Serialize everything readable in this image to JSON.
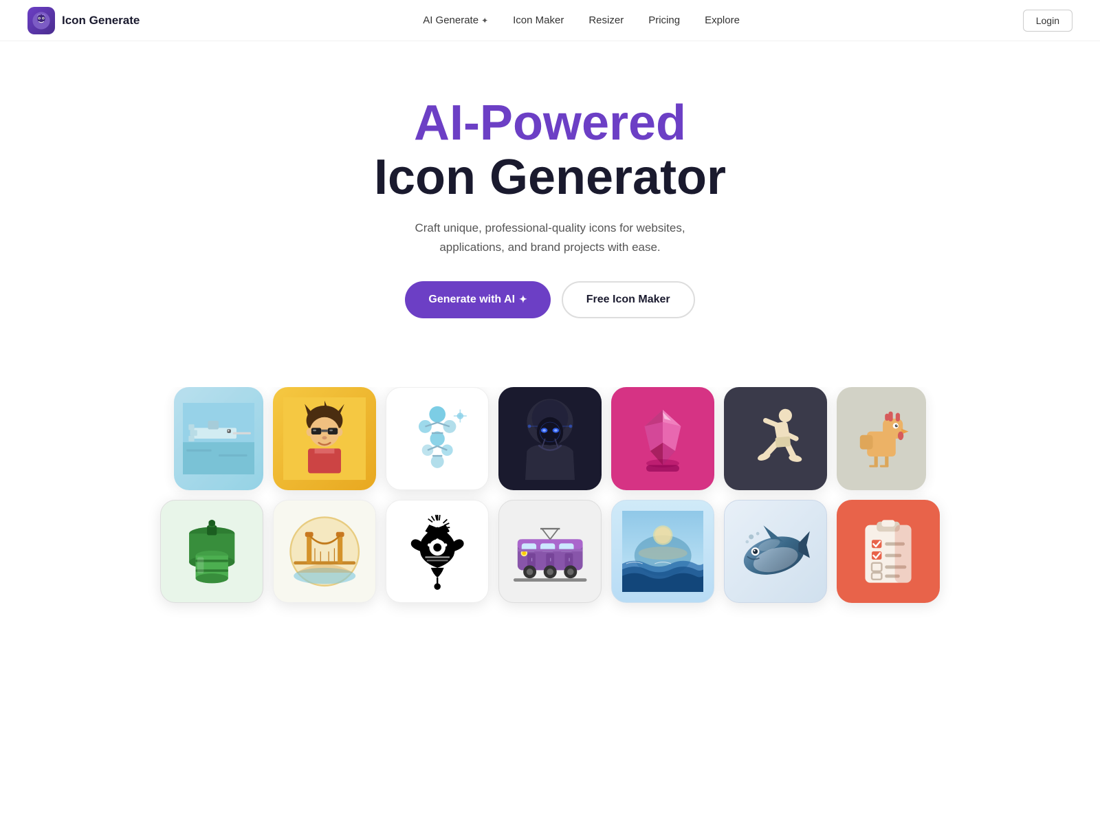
{
  "navbar": {
    "logo_text": "Icon Generate",
    "links": [
      {
        "label": "AI Generate",
        "has_sparkle": true
      },
      {
        "label": "Icon Maker",
        "has_sparkle": false
      },
      {
        "label": "Resizer",
        "has_sparkle": false
      },
      {
        "label": "Pricing",
        "has_sparkle": false
      },
      {
        "label": "Explore",
        "has_sparkle": false
      }
    ],
    "login_label": "Login"
  },
  "hero": {
    "title_ai": "AI-Powered",
    "title_main": "Icon Generator",
    "subtitle_line1": "Craft unique, professional-quality icons for websites,",
    "subtitle_line2": "applications, and brand projects with ease.",
    "cta_primary": "Generate with AI",
    "cta_secondary": "Free Icon Maker",
    "sparkle": "✦"
  },
  "gallery": {
    "row1": [
      {
        "id": "swordfish",
        "bg": "teal",
        "label": "pixel art swordfish"
      },
      {
        "id": "character",
        "bg": "yellow",
        "label": "cartoon character"
      },
      {
        "id": "dna",
        "bg": "white",
        "label": "DNA molecule"
      },
      {
        "id": "hacker",
        "bg": "dark",
        "label": "hooded hacker"
      },
      {
        "id": "gem3d",
        "bg": "pink",
        "label": "3D pink gem"
      },
      {
        "id": "runner",
        "bg": "gray-dark",
        "label": "running figure"
      },
      {
        "id": "chicken",
        "bg": "gray-light",
        "label": "pixel chicken"
      }
    ],
    "row2": [
      {
        "id": "barrels",
        "bg": "white",
        "label": "green barrels"
      },
      {
        "id": "bridge",
        "bg": "white2",
        "label": "golden bridge"
      },
      {
        "id": "ornament",
        "bg": "black-stripe",
        "label": "decorative ornament"
      },
      {
        "id": "train",
        "bg": "white",
        "label": "metro train"
      },
      {
        "id": "waves",
        "bg": "sky",
        "label": "wave landscape"
      },
      {
        "id": "whale",
        "bg": "blue-circle",
        "label": "metallic whale"
      },
      {
        "id": "checklist",
        "bg": "orange",
        "label": "checklist clipboard"
      }
    ]
  }
}
